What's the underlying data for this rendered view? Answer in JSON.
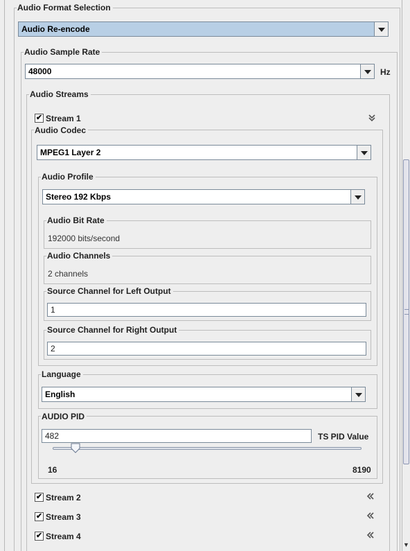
{
  "audio_format": {
    "legend": "Audio Format Selection",
    "value": "Audio Re-encode"
  },
  "sample_rate": {
    "legend": "Audio Sample Rate",
    "value": "48000",
    "unit": "Hz"
  },
  "audio_streams": {
    "legend": "Audio Streams",
    "stream1": {
      "label": "Stream 1",
      "checked": true,
      "checkmark": "✔"
    },
    "codec": {
      "legend": "Audio Codec",
      "value": "MPEG1 Layer 2"
    },
    "profile": {
      "legend": "Audio Profile",
      "value": "Stereo 192 Kbps",
      "bit_rate": {
        "legend": "Audio Bit Rate",
        "value": "192000 bits/second"
      },
      "channels": {
        "legend": "Audio Channels",
        "value": "2 channels"
      },
      "left_source": {
        "legend": "Source Channel for Left Output",
        "value": "1"
      },
      "right_source": {
        "legend": "Source Channel for Right Output",
        "value": "2"
      }
    },
    "language": {
      "legend": "Language",
      "value": "English"
    },
    "audio_pid": {
      "legend": "AUDIO PID",
      "value": "482",
      "label": "TS PID Value",
      "min": "16",
      "max": "8190",
      "slider_value": 482
    },
    "other_streams": [
      {
        "label": "Stream 2",
        "checked": true
      },
      {
        "label": "Stream 3",
        "checked": true
      },
      {
        "label": "Stream 4",
        "checked": true
      }
    ]
  },
  "icons": {
    "collapse": "chevron-double-down-icon",
    "expand": "chevron-double-left-icon"
  },
  "colors": {
    "selected_combo": "#b8cfe5",
    "panel": "#eeeeee"
  }
}
